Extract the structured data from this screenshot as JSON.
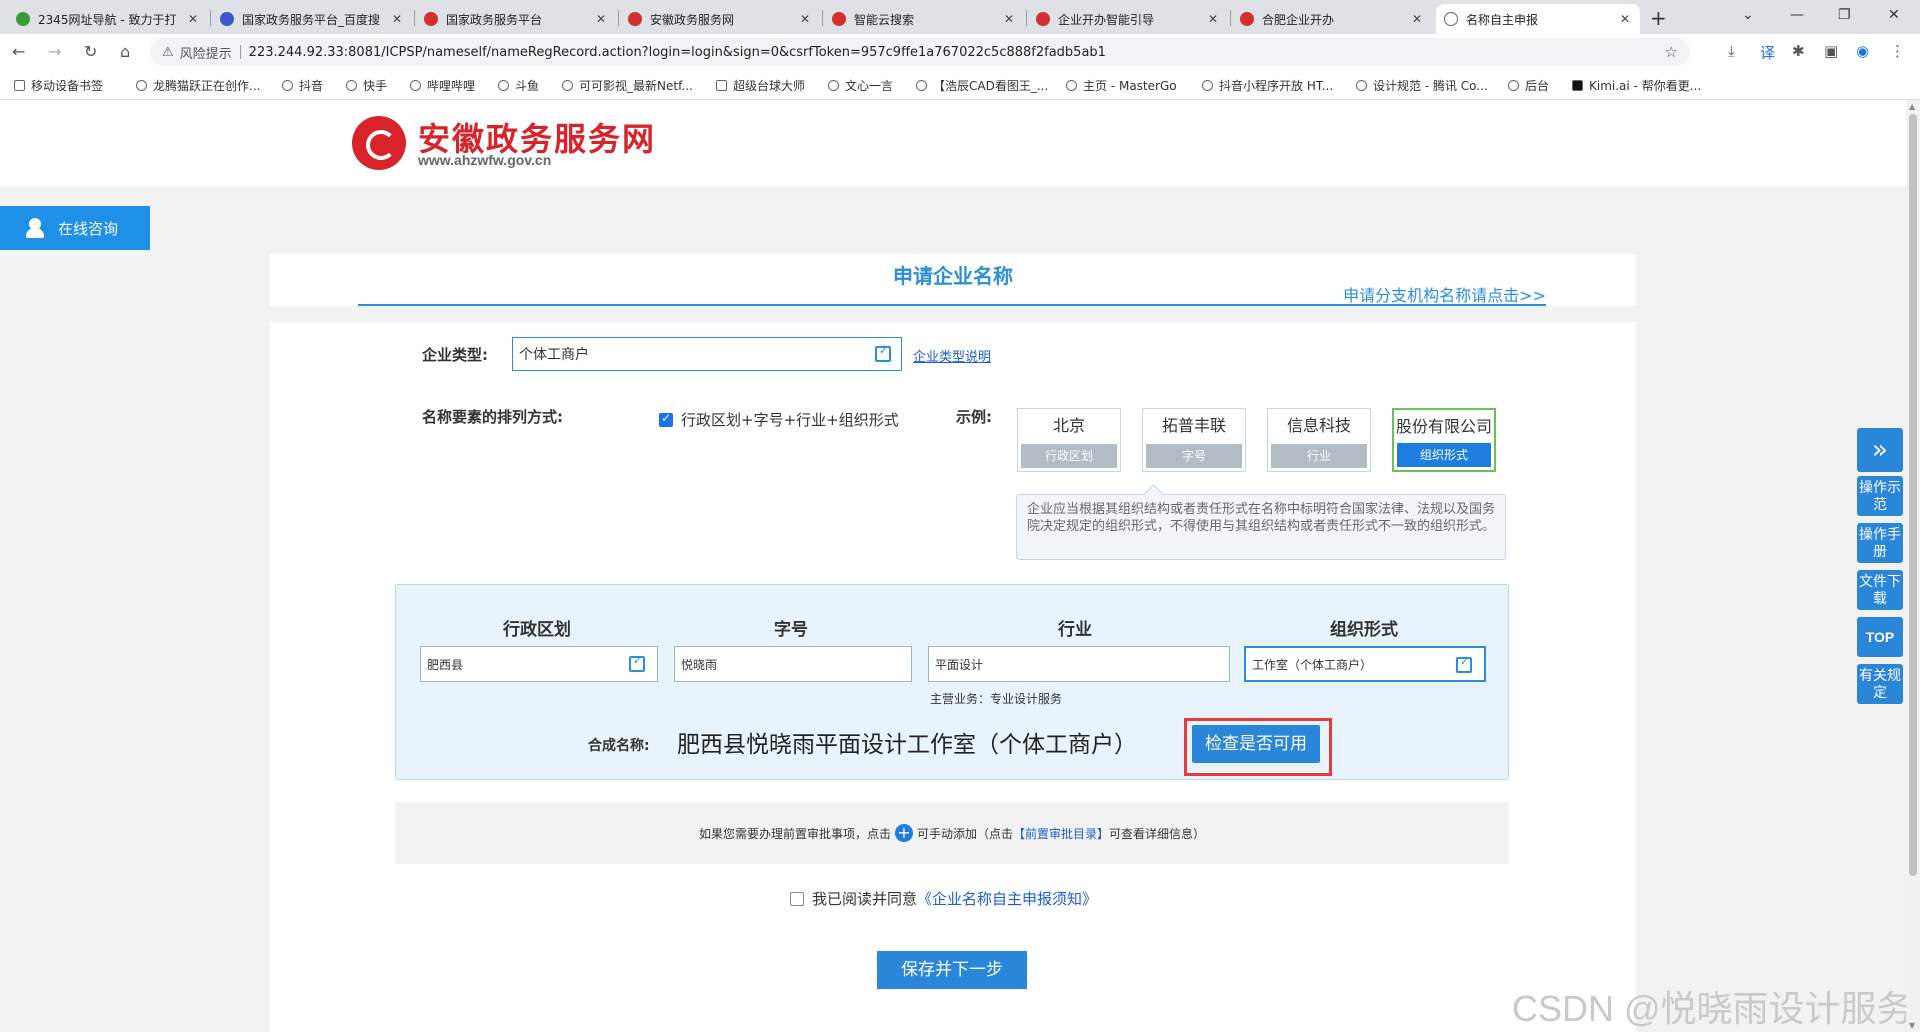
{
  "browser": {
    "tabs": [
      {
        "title": "2345网址导航 - 致力于打"
      },
      {
        "title": "国家政务服务平台_百度搜"
      },
      {
        "title": "国家政务服务平台"
      },
      {
        "title": "安徽政务服务网"
      },
      {
        "title": "智能云搜索"
      },
      {
        "title": "企业开办智能引导"
      },
      {
        "title": "合肥企业开办"
      },
      {
        "title": "名称自主申报"
      }
    ],
    "close_glyph": "✕",
    "new_tab": "+",
    "security_warning": "风险提示",
    "url": "223.244.92.33:8081/ICPSP/nameself/nameRegRecord.action?login=login&sign=0&csrfToken=957c9ffe1a767022c5c888f2fadb5ab1",
    "bookmarks": [
      "移动设备书签",
      "龙腾猫跃正在创作...",
      "抖音",
      "快手",
      "哔哩哔哩",
      "斗鱼",
      "可可影视_最新Netf...",
      "超级台球大师",
      "文心一言",
      "【浩辰CAD看图王_...",
      "主页 - MasterGo",
      "抖音小程序开放 HT...",
      "设计规范 - 腾讯 Co...",
      "后台",
      "Kimi.ai - 帮你看更..."
    ]
  },
  "site": {
    "logo_title": "安徽政务服务网",
    "logo_url": "www.ahzwfw.gov.cn",
    "consult": "在线咨询"
  },
  "header": {
    "title": "申请企业名称",
    "branch_link": "申请分支机构名称请点击>>"
  },
  "form": {
    "enterprise_type_label": "企业类型:",
    "enterprise_type_value": "个体工商户",
    "enterprise_type_help": "企业类型说明",
    "order_label": "名称要素的排列方式:",
    "order_option": "行政区划+字号+行业+组织形式",
    "example_label": "示例:",
    "examples": [
      {
        "top": "北京",
        "bottom": "行政区划"
      },
      {
        "top": "拓普丰联",
        "bottom": "字号"
      },
      {
        "top": "信息科技",
        "bottom": "行业"
      },
      {
        "top": "股份有限公司",
        "bottom": "组织形式"
      }
    ],
    "example_note": "企业应当根据其组织结构或者责任形式在名称中标明符合国家法律、法规以及国务院决定规定的组织形式，不得使用与其组织结构或者责任形式不一致的组织形式。"
  },
  "compose": {
    "headers": [
      "行政区划",
      "字号",
      "行业",
      "组织形式"
    ],
    "values": [
      "肥西县",
      "悦晓雨",
      "平面设计",
      "工作室（个体工商户）"
    ],
    "main_business": "主营业务：专业设计服务",
    "combined_label": "合成名称:",
    "combined_name": "肥西县悦晓雨平面设计工作室（个体工商户）",
    "check_button": "检查是否可用"
  },
  "prereq": {
    "text_before": "如果您需要办理前置审批事项，点击",
    "text_mid": "可手动添加（点击",
    "link": "【前置审批目录】",
    "text_after": "可查看详细信息）",
    "plus": "+"
  },
  "agreement": {
    "text": "我已阅读并同意",
    "link": "《企业名称自主申报须知》"
  },
  "save_button": "保存并下一步",
  "side_tools": {
    "collapse": "»",
    "demo": "操作示范",
    "manual": "操作手册",
    "download": "文件下载",
    "top": "TOP",
    "rules": "有关规定"
  },
  "watermark": "CSDN @悦晓雨设计服务",
  "colors": {
    "accent": "#2a86d8",
    "brand_red": "#d8232a",
    "highlight": "#e83a3a",
    "selected_border": "#6bc05a"
  }
}
